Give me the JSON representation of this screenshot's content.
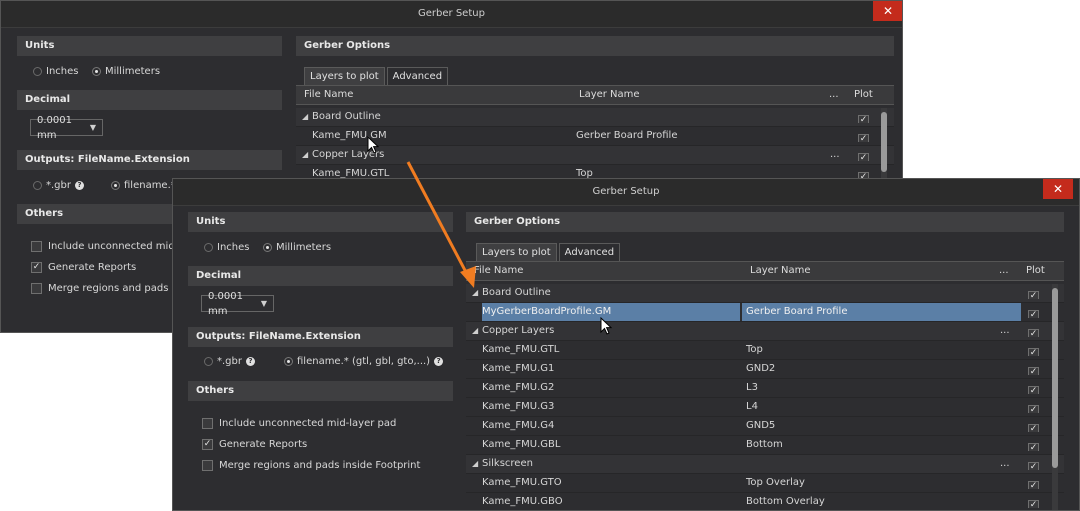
{
  "back": {
    "title": "Gerber Setup",
    "close": "✕",
    "units_title": "Units",
    "units_inches": "Inches",
    "units_mm": "Millimeters",
    "decimal_title": "Decimal",
    "decimal_value": "0.0001 mm",
    "outputs_title": "Outputs: FileName.Extension",
    "outputs_gbr": "*.gbr",
    "outputs_filename": "filename.*",
    "others_title": "Others",
    "others": [
      "Include unconnected mid-la",
      "Generate Reports",
      "Merge regions and pads ins"
    ],
    "options_title": "Gerber Options",
    "tab1": "Layers to plot",
    "tab2": "Advanced",
    "col_file": "File Name",
    "col_layer": "Layer Name",
    "col_dots": "...",
    "col_plot": "Plot",
    "rows": [
      {
        "type": "group",
        "file": "Board Outline",
        "layer": "",
        "dots": ""
      },
      {
        "type": "item",
        "file": "Kame_FMU.GM",
        "layer": "Gerber Board Profile",
        "dots": ""
      },
      {
        "type": "group",
        "file": "Copper Layers",
        "layer": "",
        "dots": "..."
      },
      {
        "type": "item",
        "file": "Kame_FMU.GTL",
        "layer": "Top",
        "dots": ""
      }
    ]
  },
  "front": {
    "title": "Gerber Setup",
    "close": "✕",
    "units_title": "Units",
    "units_inches": "Inches",
    "units_mm": "Millimeters",
    "decimal_title": "Decimal",
    "decimal_value": "0.0001 mm",
    "outputs_title": "Outputs: FileName.Extension",
    "outputs_gbr": "*.gbr",
    "outputs_filename": "filename.* (gtl, gbl, gto,...)",
    "others_title": "Others",
    "others": [
      "Include unconnected mid-layer pad",
      "Generate Reports",
      "Merge regions and pads inside Footprint"
    ],
    "others_checked": [
      false,
      true,
      false
    ],
    "options_title": "Gerber Options",
    "tab1": "Layers to plot",
    "tab2": "Advanced",
    "col_file": "File Name",
    "col_layer": "Layer Name",
    "col_dots": "...",
    "col_plot": "Plot",
    "rows": [
      {
        "type": "group",
        "file": "Board Outline",
        "layer": "",
        "dots": ""
      },
      {
        "type": "sel",
        "file": "MyGerberBoardProfile.GM",
        "layer": "Gerber Board Profile",
        "dots": ""
      },
      {
        "type": "group",
        "file": "Copper Layers",
        "layer": "",
        "dots": "..."
      },
      {
        "type": "item",
        "file": "Kame_FMU.GTL",
        "layer": "Top",
        "dots": ""
      },
      {
        "type": "item",
        "file": "Kame_FMU.G1",
        "layer": "GND2",
        "dots": ""
      },
      {
        "type": "item",
        "file": "Kame_FMU.G2",
        "layer": "L3",
        "dots": ""
      },
      {
        "type": "item",
        "file": "Kame_FMU.G3",
        "layer": "L4",
        "dots": ""
      },
      {
        "type": "item",
        "file": "Kame_FMU.G4",
        "layer": "GND5",
        "dots": ""
      },
      {
        "type": "item",
        "file": "Kame_FMU.GBL",
        "layer": "Bottom",
        "dots": ""
      },
      {
        "type": "group",
        "file": "Silkscreen",
        "layer": "",
        "dots": "..."
      },
      {
        "type": "item",
        "file": "Kame_FMU.GTO",
        "layer": "Top Overlay",
        "dots": ""
      },
      {
        "type": "item",
        "file": "Kame_FMU.GBO",
        "layer": "Bottom Overlay",
        "dots": ""
      }
    ]
  },
  "colors": {
    "arrow": "#f07c21",
    "selection": "#5b7fa6",
    "close": "#c42b1c"
  }
}
